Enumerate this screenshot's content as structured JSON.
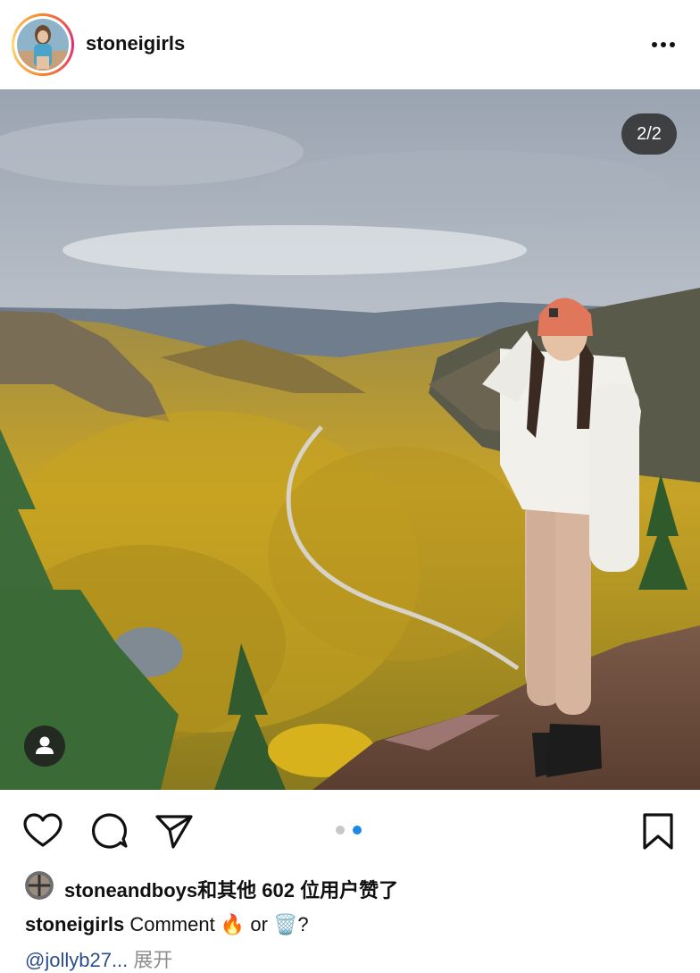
{
  "post": {
    "username": "stoneigirls",
    "image_counter": "2/2",
    "image_description": "",
    "carousel": {
      "total": 2,
      "active_index": 1
    }
  },
  "likes": {
    "user": "stoneandboys",
    "text_suffix": "和其他 602 位用户赞了"
  },
  "caption": {
    "username": "stoneigirls",
    "text": " Comment 🔥 or 🗑️?"
  },
  "comment_preview": {
    "mention": "@jollyb27...",
    "more_label": "展开"
  },
  "icons": {
    "more": "more-horizontal-icon",
    "like": "heart-icon",
    "comment": "comment-icon",
    "share": "send-icon",
    "save": "bookmark-icon",
    "tag": "user-tag-icon"
  },
  "colors": {
    "accent_blue": "#1e88e5",
    "dot_inactive": "#c8c8c8",
    "mention_blue": "#2b4d8a",
    "muted": "#8e8e8e"
  }
}
